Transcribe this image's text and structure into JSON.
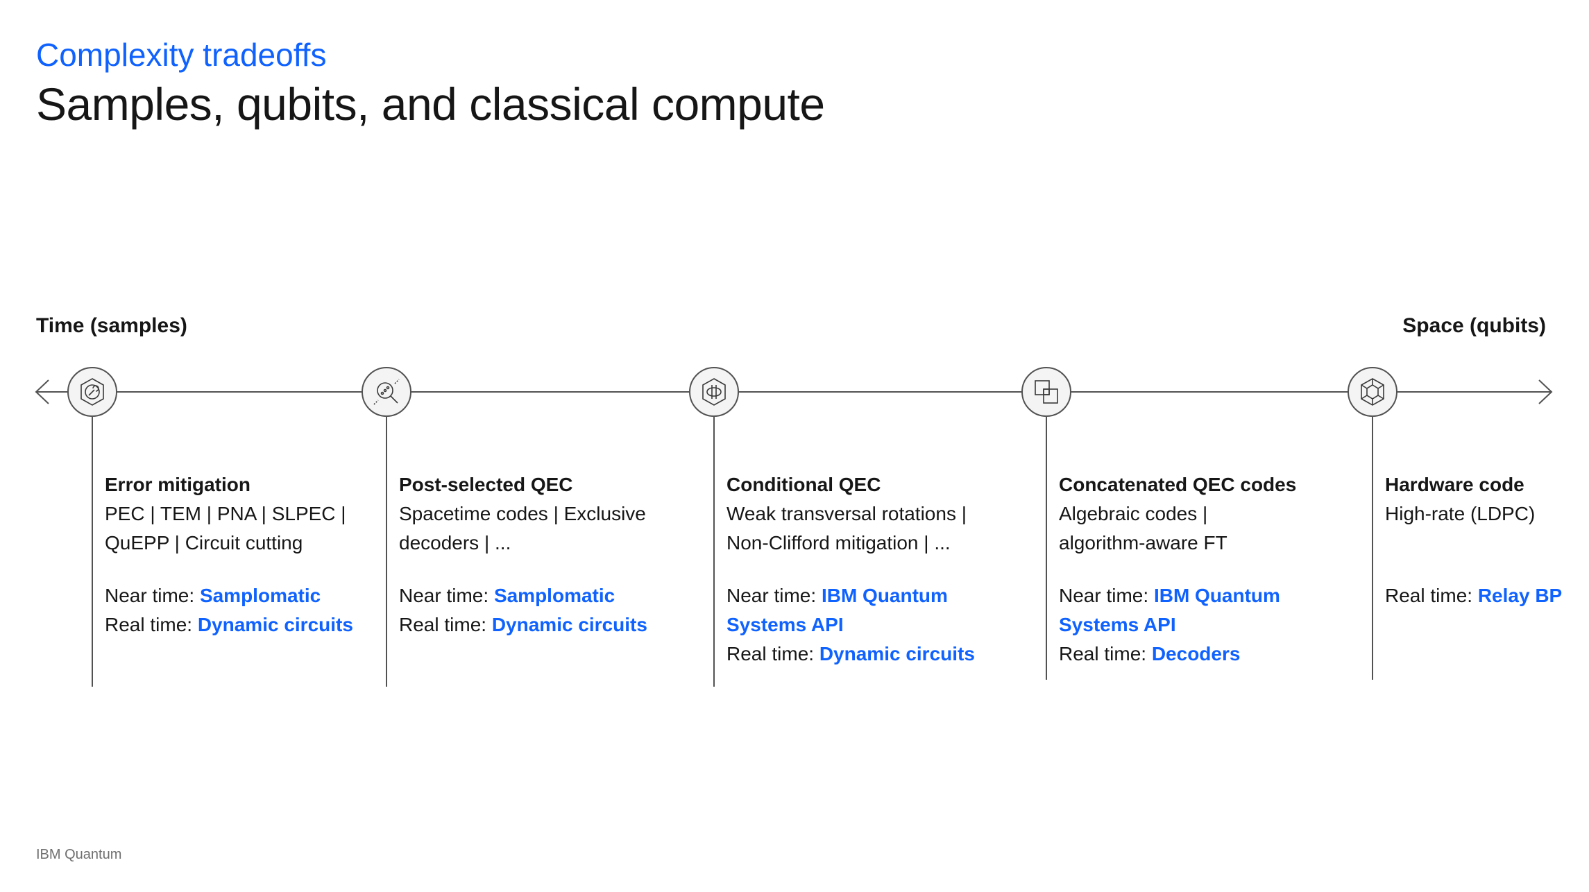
{
  "header": {
    "eyebrow": "Complexity tradeoffs",
    "title": "Samples, qubits, and classical compute"
  },
  "axis": {
    "left_label": "Time (samples)",
    "right_label": "Space (qubits)"
  },
  "stages": [
    {
      "icon": "gear-hexagon-icon",
      "title": "Error mitigation",
      "desc_lines": [
        "PEC | TEM | PNA | SLPEC |",
        "QuEPP | Circuit cutting"
      ],
      "near_label": "Near time: ",
      "near_value_lines": [
        "Samplomatic"
      ],
      "real_label": "Real time: ",
      "real_value": "Dynamic circuits"
    },
    {
      "icon": "magnifier-icon",
      "title": "Post-selected QEC",
      "desc_lines": [
        "Spacetime codes | Exclusive",
        "decoders | ..."
      ],
      "near_label": "Near time: ",
      "near_value_lines": [
        "Samplomatic"
      ],
      "real_label": "Real time: ",
      "real_value": "Dynamic circuits"
    },
    {
      "icon": "hexagon-pulse-icon",
      "title": "Conditional QEC",
      "desc_lines": [
        "Weak transversal rotations |",
        "Non-Clifford mitigation | ..."
      ],
      "near_label": "Near time: ",
      "near_value_lines": [
        "IBM Quantum",
        "Systems API"
      ],
      "real_label": "Real time: ",
      "real_value": "Dynamic circuits"
    },
    {
      "icon": "overlapping-squares-icon",
      "title": "Concatenated QEC codes",
      "desc_lines": [
        "Algebraic codes |",
        "algorithm-aware FT"
      ],
      "near_label": "Near time: ",
      "near_value_lines": [
        "IBM Quantum",
        "Systems API"
      ],
      "real_label": "Real time: ",
      "real_value": "Decoders"
    },
    {
      "icon": "hexagon-lattice-icon",
      "title": "Hardware code",
      "desc_lines": [
        "High-rate (LDPC)",
        ""
      ],
      "near_label": "",
      "near_value_lines": [],
      "real_label": "Real time: ",
      "real_value": "Relay BP"
    }
  ],
  "footer": {
    "brand": "IBM Quantum"
  }
}
